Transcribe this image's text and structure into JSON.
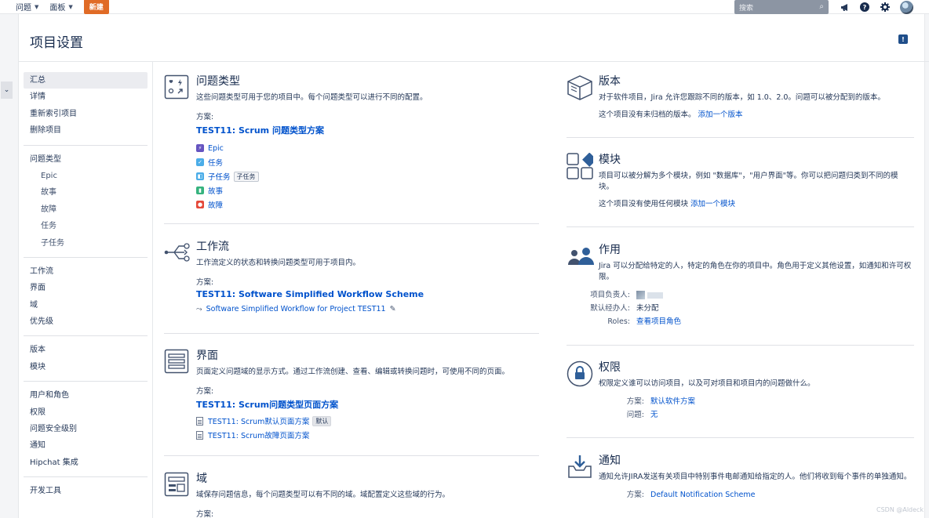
{
  "topbar": {
    "nav": [
      {
        "label": "问题"
      },
      {
        "label": "面板"
      }
    ],
    "create_label": "新建",
    "search_placeholder": "搜索"
  },
  "page": {
    "title": "项目设置"
  },
  "sidebar": {
    "groups": [
      [
        {
          "label": "汇总",
          "active": true
        },
        {
          "label": "详情"
        },
        {
          "label": "重新索引项目"
        },
        {
          "label": "删除项目"
        }
      ],
      [
        {
          "label": "问题类型"
        },
        {
          "label": "Epic",
          "sub": true
        },
        {
          "label": "故事",
          "sub": true
        },
        {
          "label": "故障",
          "sub": true
        },
        {
          "label": "任务",
          "sub": true
        },
        {
          "label": "子任务",
          "sub": true
        }
      ],
      [
        {
          "label": "工作流"
        },
        {
          "label": "界面"
        },
        {
          "label": "域"
        },
        {
          "label": "优先级"
        }
      ],
      [
        {
          "label": "版本"
        },
        {
          "label": "模块"
        }
      ],
      [
        {
          "label": "用户和角色"
        },
        {
          "label": "权限"
        },
        {
          "label": "问题安全级别"
        },
        {
          "label": "通知"
        },
        {
          "label": "Hipchat 集成"
        }
      ],
      [
        {
          "label": "开发工具"
        }
      ]
    ]
  },
  "issue_types": {
    "title": "问题类型",
    "desc": "这些问题类型可用于您的项目中。每个问题类型可以进行不同的配置。",
    "scheme_label": "方案:",
    "scheme_name": "TEST11: Scrum 问题类型方案",
    "types": [
      {
        "label": "Epic",
        "color": "#6554c0",
        "glyph": "⚡"
      },
      {
        "label": "任务",
        "color": "#4bade8",
        "glyph": "✓"
      },
      {
        "label": "子任务",
        "color": "#4bade8",
        "glyph": "◧",
        "tag": "子任务"
      },
      {
        "label": "故事",
        "color": "#36b37e",
        "glyph": "▮"
      },
      {
        "label": "故障",
        "color": "#e5493a",
        "glyph": "●"
      }
    ]
  },
  "workflow": {
    "title": "工作流",
    "desc": "工作流定义的状态和转换问题类型可用于项目内。",
    "scheme_label": "方案:",
    "scheme_name": "TEST11: Software Simplified Workflow Scheme",
    "item": "Software Simplified Workflow for Project TEST11"
  },
  "screens": {
    "title": "界面",
    "desc": "页面定义问题域的显示方式。通过工作流创建、查看、编辑或转换问题时，可使用不同的页面。",
    "scheme_label": "方案:",
    "scheme_name": "TEST11: Scrum问题类型页面方案",
    "items": [
      {
        "label": "TEST11: Scrum默认页面方案",
        "tag": "默认"
      },
      {
        "label": "TEST11: Scrum故障页面方案"
      }
    ]
  },
  "fields": {
    "title": "域",
    "desc": "域保存问题信息，每个问题类型可以有不同的域。域配置定义这些域的行为。",
    "scheme_label": "方案:"
  },
  "versions": {
    "title": "版本",
    "desc": "对于软件项目，Jira 允许您跟踪不同的版本，如 1.0、2.0。问题可以被分配到的版本。",
    "none_text": "这个项目没有未归档的版本。",
    "add_link": "添加一个版本"
  },
  "components": {
    "title": "模块",
    "desc": "项目可以被分解为多个模块，例如 \"数据库\"，\"用户界面\"等。你可以把问题归类到不同的模块。",
    "none_text": "这个项目没有使用任何模块",
    "add_link": "添加一个模块"
  },
  "roles": {
    "title": "作用",
    "desc": "Jira 可以分配给特定的人，特定的角色在你的项目中。角色用于定义其他设置，如通知和许可权限。",
    "lead_label": "项目负责人:",
    "assignee_label": "默认经办人:",
    "assignee_value": "未分配",
    "roles_label": "Roles:",
    "roles_link": "查看项目角色"
  },
  "permissions": {
    "title": "权限",
    "desc": "权限定义谁可以访问项目，以及可对项目和项目内的问题做什么。",
    "scheme_label": "方案:",
    "scheme_value": "默认软件方案",
    "issue_label": "问题:",
    "issue_value": "无"
  },
  "notifications": {
    "title": "通知",
    "desc": "通知允许JIRA发送有关项目中特别事件电邮通知给指定的人。他们将收到每个事件的单独通知。",
    "scheme_label": "方案:",
    "scheme_value": "Default Notification Scheme"
  },
  "watermark": "CSDN @Aldeck"
}
